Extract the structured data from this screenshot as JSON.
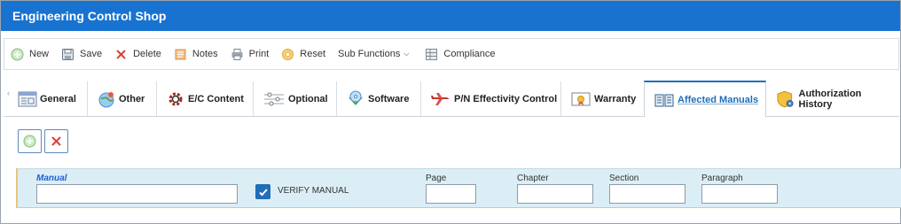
{
  "window": {
    "title": "Engineering Control Shop"
  },
  "toolbar": {
    "new_label": "New",
    "save_label": "Save",
    "delete_label": "Delete",
    "notes_label": "Notes",
    "print_label": "Print",
    "reset_label": "Reset",
    "subfunctions_label": "Sub Functions",
    "compliance_label": "Compliance"
  },
  "tabs": [
    {
      "label": "General",
      "icon": "general-icon"
    },
    {
      "label": "Other",
      "icon": "globe-icon"
    },
    {
      "label": "E/C Content",
      "icon": "gear-icon"
    },
    {
      "label": "Optional",
      "icon": "sliders-icon"
    },
    {
      "label": "Software",
      "icon": "disc-icon"
    },
    {
      "label": "P/N Effectivity Control",
      "icon": "airplane-icon"
    },
    {
      "label": "Warranty",
      "icon": "certificate-icon"
    },
    {
      "label": "Affected Manuals",
      "icon": "book-icon",
      "active": true
    },
    {
      "label": "Authorization History",
      "icon": "shield-gear-icon"
    }
  ],
  "form": {
    "manual_label": "Manual",
    "manual_value": "",
    "verify_label": "VERIFY MANUAL",
    "verify_checked": true,
    "page_label": "Page",
    "page_value": "",
    "chapter_label": "Chapter",
    "chapter_value": "",
    "section_label": "Section",
    "section_value": "",
    "paragraph_label": "Paragraph",
    "paragraph_value": ""
  },
  "colors": {
    "title_bar": "#1873d0",
    "active_tab": "#1b6fbe",
    "form_panel": "#dbeef5",
    "checkbox": "#1f6eb8"
  }
}
